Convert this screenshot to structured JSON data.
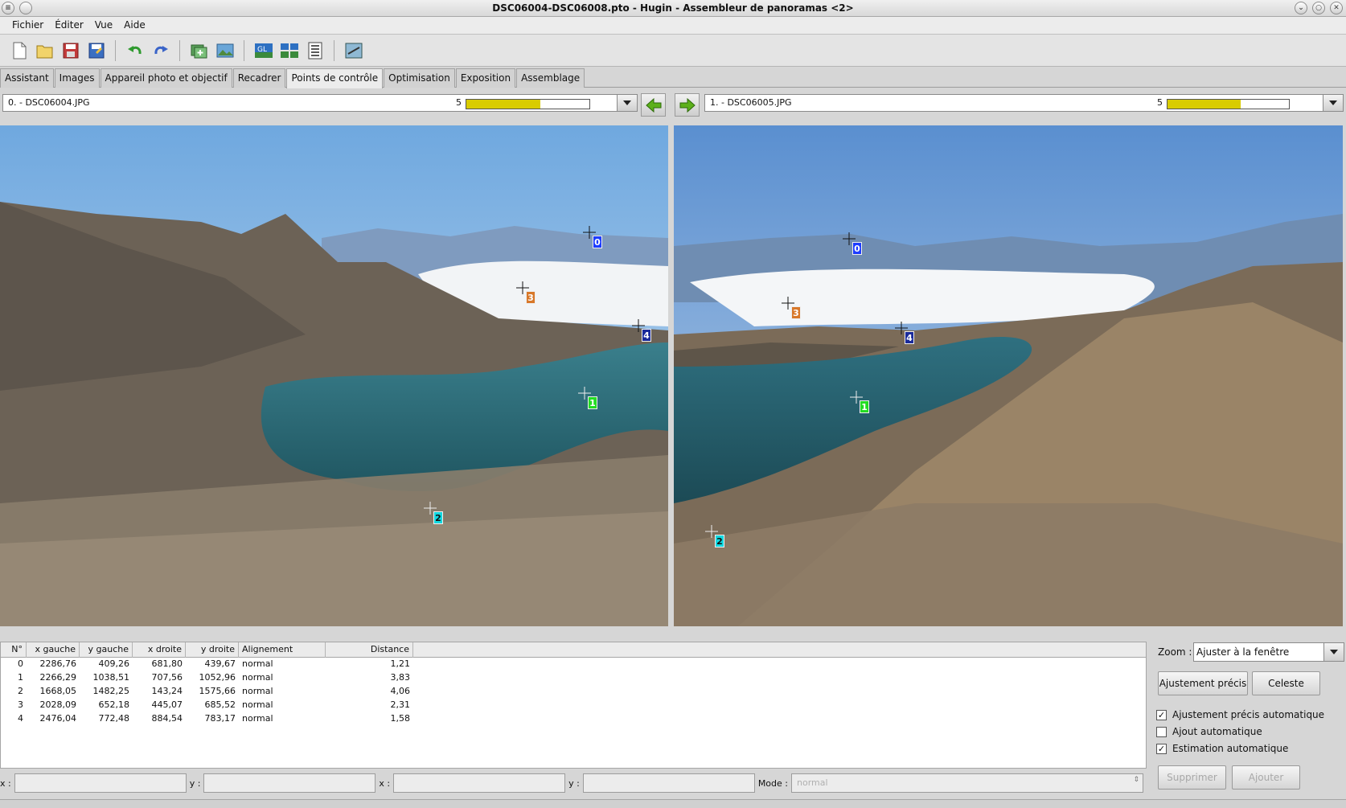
{
  "window": {
    "title": "DSC06004-DSC06008.pto - Hugin - Assembleur de panoramas <2>"
  },
  "menu": [
    "Fichier",
    "Éditer",
    "Vue",
    "Aide"
  ],
  "toolbar_icons": [
    "new-project-icon",
    "open-project-icon",
    "save-icon",
    "save-as-icon",
    "undo-icon",
    "redo-icon",
    "add-images-icon",
    "add-time-series-icon",
    "fast-preview-icon",
    "preview-icon",
    "control-points-table-icon",
    "optimize-icon"
  ],
  "tabs": [
    "Assistant",
    "Images",
    "Appareil photo et objectif",
    "Recadrer",
    "Points de contrôle",
    "Optimisation",
    "Exposition",
    "Assemblage"
  ],
  "active_tab": "Points de contrôle",
  "left_image": {
    "label": "0. - DSC06004.JPG",
    "count": "5",
    "bar_fraction": 0.6
  },
  "right_image": {
    "label": "1. - DSC06005.JPG",
    "count": "5",
    "bar_fraction": 0.6
  },
  "markers": {
    "left": [
      "0",
      "3",
      "4",
      "1",
      "2"
    ],
    "right": [
      "0",
      "3",
      "4",
      "1",
      "2"
    ]
  },
  "marker_colors": {
    "0": "#1d3cff",
    "1": "#22dd22",
    "2": "#11d8e0",
    "3": "#d8782a",
    "4": "#1a2a9a"
  },
  "table": {
    "headers": [
      "N°",
      "x gauche",
      "y gauche",
      "x droite",
      "y droite",
      "Alignement",
      "Distance"
    ],
    "rows": [
      [
        "0",
        "2286,76",
        "409,26",
        "681,80",
        "439,67",
        "normal",
        "1,21"
      ],
      [
        "1",
        "2266,29",
        "1038,51",
        "707,56",
        "1052,96",
        "normal",
        "3,83"
      ],
      [
        "2",
        "1668,05",
        "1482,25",
        "143,24",
        "1575,66",
        "normal",
        "4,06"
      ],
      [
        "3",
        "2028,09",
        "652,18",
        "445,07",
        "685,52",
        "normal",
        "2,31"
      ],
      [
        "4",
        "2476,04",
        "772,48",
        "884,54",
        "783,17",
        "normal",
        "1,58"
      ]
    ]
  },
  "coords": {
    "x1_label": "x :",
    "y1_label": "y :",
    "x2_label": "x :",
    "y2_label": "y :",
    "mode_label": "Mode :",
    "mode_value": "normal"
  },
  "panel": {
    "zoom_label": "Zoom :",
    "zoom_value": "Ajuster à la fenêtre",
    "fine_tune": "Ajustement précis",
    "celeste": "Celeste",
    "chk_auto_fine": "Ajustement précis automatique",
    "chk_auto_add": "Ajout automatique",
    "chk_auto_estimate": "Estimation automatique",
    "chk_auto_fine_checked": "✓",
    "chk_auto_add_checked": "",
    "chk_auto_estimate_checked": "✓",
    "delete": "Supprimer",
    "add": "Ajouter"
  }
}
